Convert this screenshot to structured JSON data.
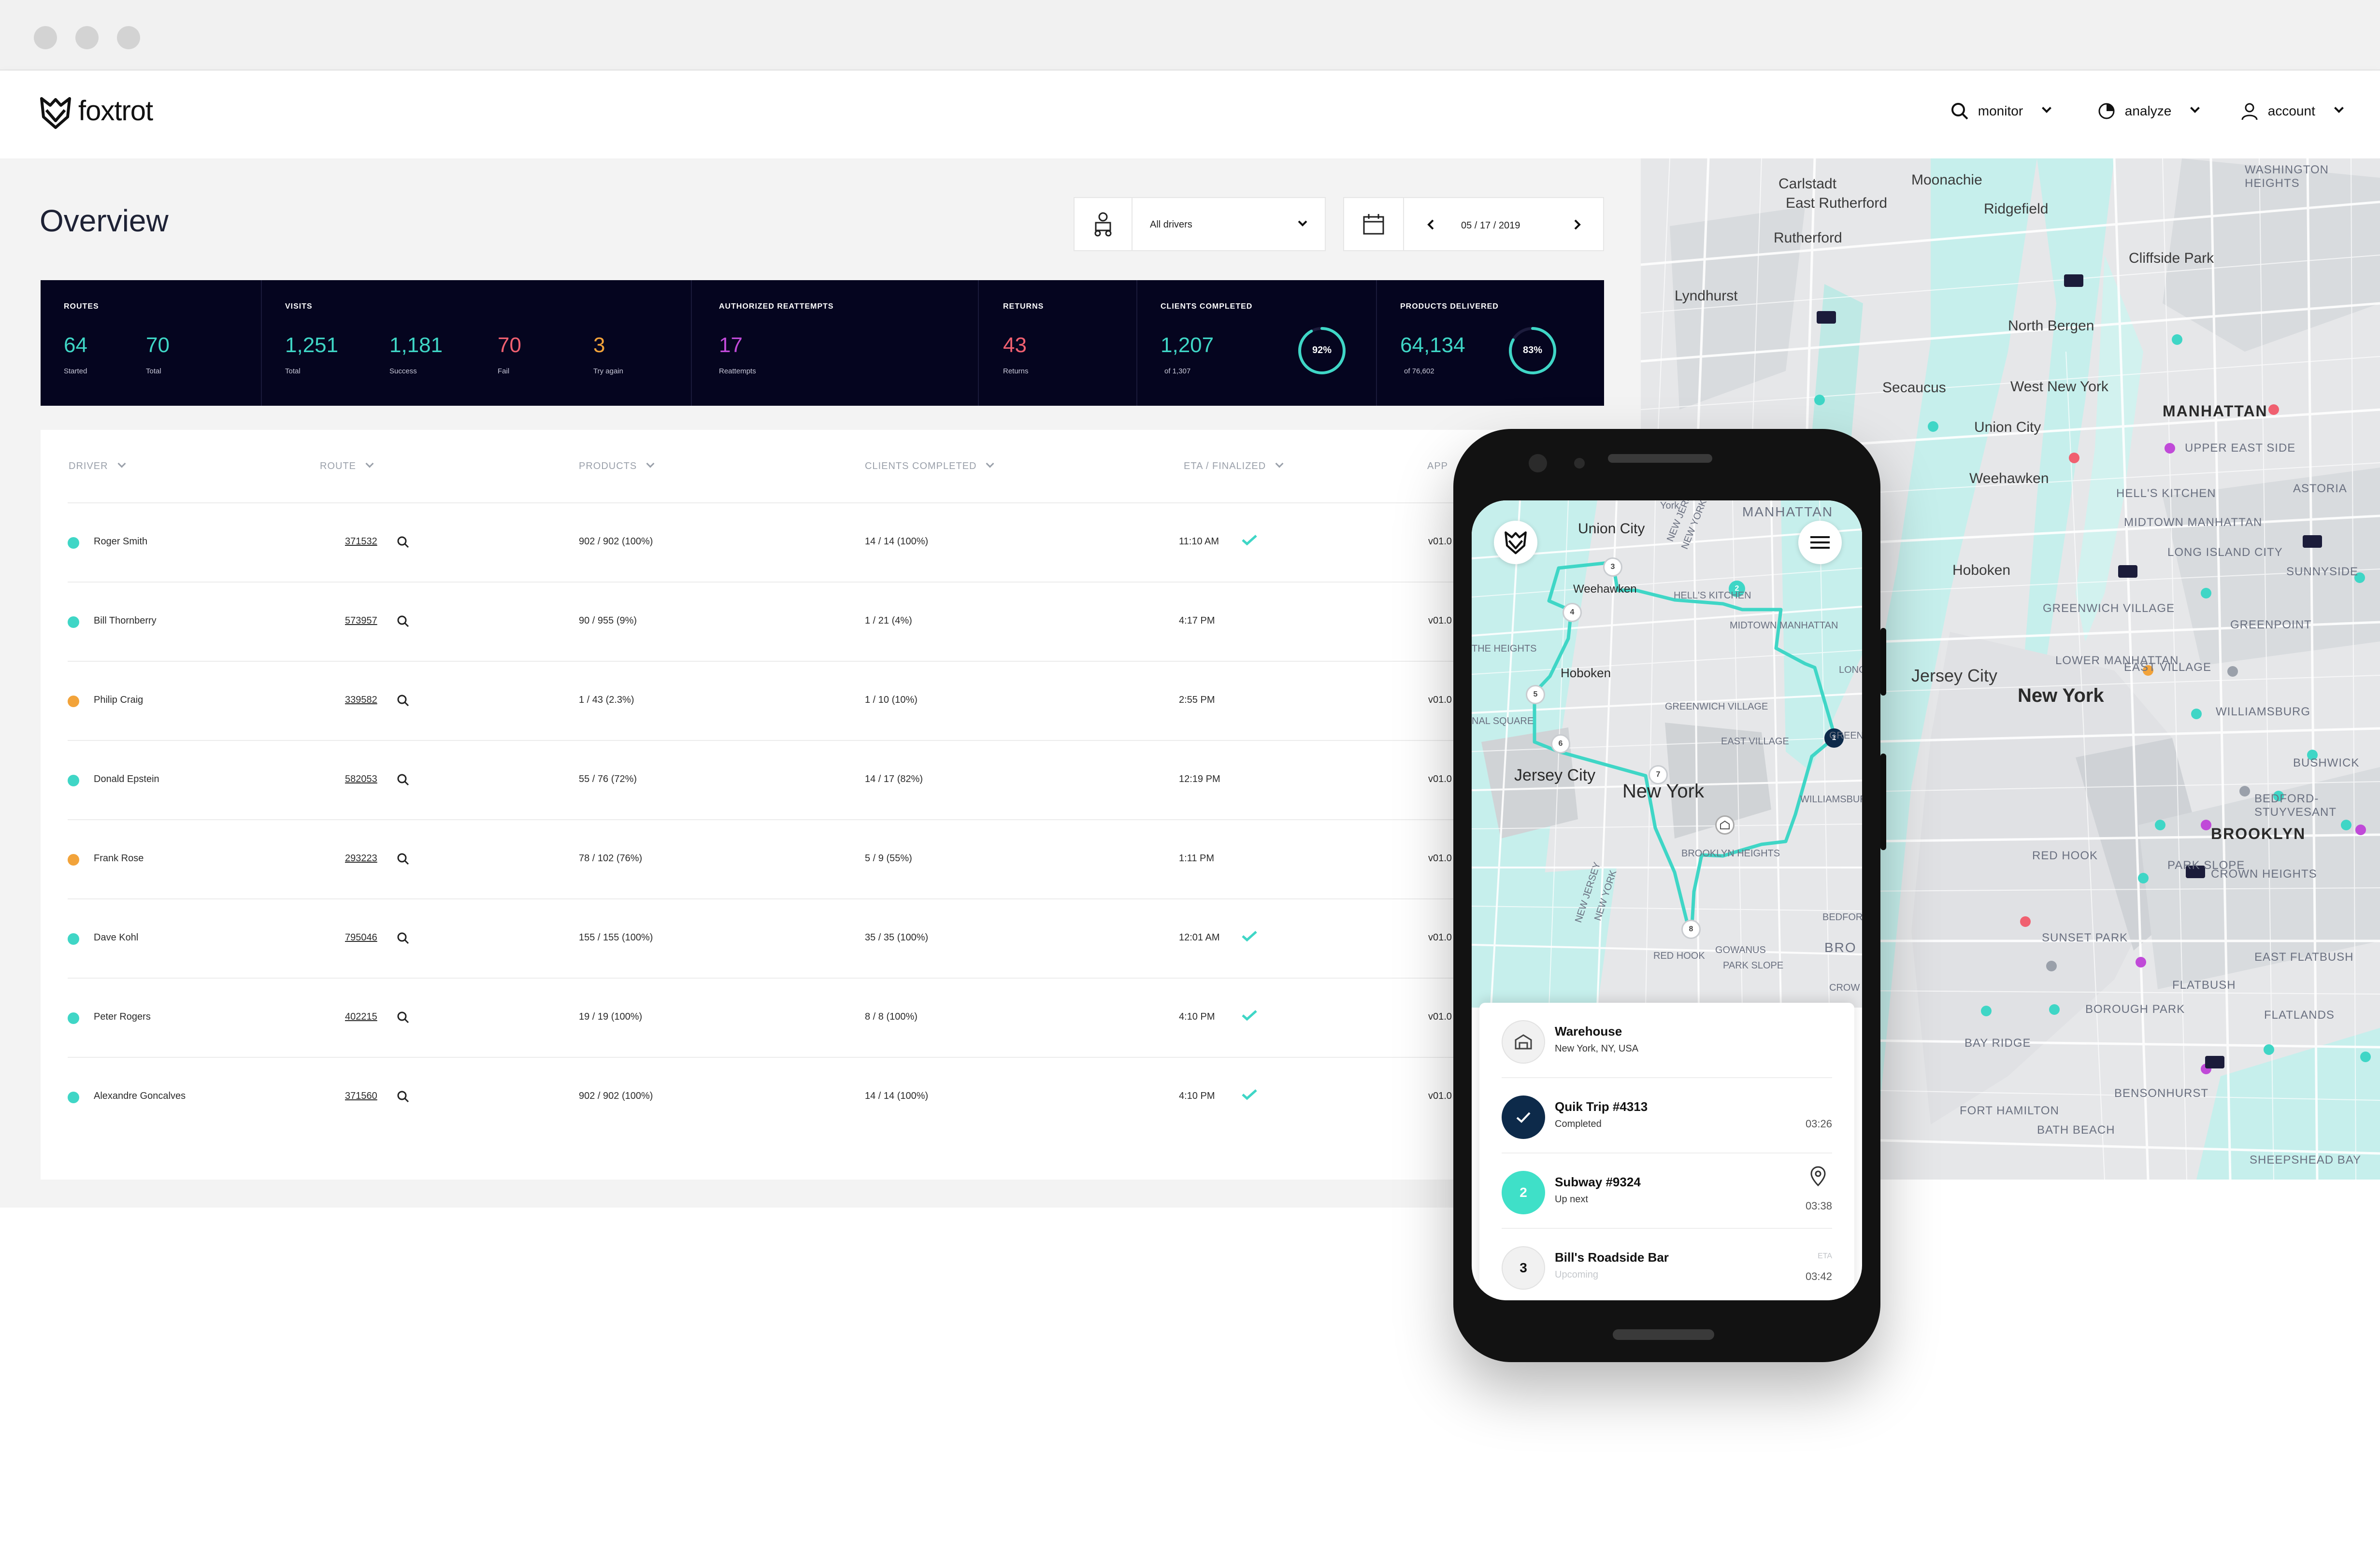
{
  "app": {
    "brand": "foxtrot"
  },
  "nav": {
    "monitor": "monitor",
    "analyze": "analyze",
    "account": "account"
  },
  "overview": {
    "title": "Overview",
    "driver_filter": "All drivers",
    "date": "05 / 17 / 2019"
  },
  "stats": {
    "routes": {
      "label": "ROUTES",
      "started": "64",
      "started_label": "Started",
      "total": "70",
      "total_label": "Total"
    },
    "visits": {
      "label": "VISITS",
      "total": "1,251",
      "total_label": "Total",
      "success": "1,181",
      "success_label": "Success",
      "fail": "70",
      "fail_label": "Fail",
      "try_again": "3",
      "try_again_label": "Try again"
    },
    "reattempts": {
      "label": "AUTHORIZED REATTEMPTS",
      "value": "17",
      "sub": "Reattempts"
    },
    "returns": {
      "label": "RETURNS",
      "value": "43",
      "sub": "Returns"
    },
    "clients": {
      "label": "CLIENTS COMPLETED",
      "value": "1,207",
      "sub": "of 1,307",
      "percent_label": "92%",
      "percent": 0.92
    },
    "products": {
      "label": "PRODUCTS DELIVERED",
      "value": "64,134",
      "sub": "of 76,602",
      "percent_label": "83%",
      "percent": 0.83
    }
  },
  "table": {
    "headers": {
      "driver": "DRIVER",
      "route": "ROUTE",
      "products": "PRODUCTS",
      "clients": "CLIENTS COMPLETED",
      "eta": "ETA / FINALIZED",
      "app": "APP"
    },
    "rows": [
      {
        "driver": "Roger Smith",
        "status": "#3fd6c6",
        "route": "371532",
        "products": "902 / 902 (100%)",
        "clients": "14 / 14 (100%)",
        "eta": "11:10 AM",
        "done": true,
        "app": "v01.0"
      },
      {
        "driver": "Bill Thornberry",
        "status": "#3fd6c6",
        "route": "573957",
        "products": "90 / 955 (9%)",
        "clients": "1 / 21 (4%)",
        "eta": "4:17 PM",
        "done": false,
        "app": "v01.0"
      },
      {
        "driver": "Philip Craig",
        "status": "#f2a33a",
        "route": "339582",
        "products": "1 / 43 (2.3%)",
        "clients": "1 / 10 (10%)",
        "eta": "2:55 PM",
        "done": false,
        "app": "v01.0"
      },
      {
        "driver": "Donald Epstein",
        "status": "#3fd6c6",
        "route": "582053",
        "products": "55 / 76 (72%)",
        "clients": "14 / 17 (82%)",
        "eta": "12:19 PM",
        "done": false,
        "app": "v01.0"
      },
      {
        "driver": "Frank Rose",
        "status": "#f2a33a",
        "route": "293223",
        "products": "78 / 102 (76%)",
        "clients": "5 / 9 (55%)",
        "eta": "1:11 PM",
        "done": false,
        "app": "v01.0"
      },
      {
        "driver": "Dave Kohl",
        "status": "#3fd6c6",
        "route": "795046",
        "products": "155 / 155 (100%)",
        "clients": "35 / 35 (100%)",
        "eta": "12:01 AM",
        "done": true,
        "app": "v01.0"
      },
      {
        "driver": "Peter Rogers",
        "status": "#3fd6c6",
        "route": "402215",
        "products": "19 / 19 (100%)",
        "clients": "8 / 8 (100%)",
        "eta": "4:10 PM",
        "done": true,
        "app": "v01.0"
      },
      {
        "driver": "Alexandre Goncalves",
        "status": "#3fd6c6",
        "route": "371560",
        "products": "902 / 902 (100%)",
        "clients": "14 / 14 (100%)",
        "eta": "4:10 PM",
        "done": true,
        "app": "v01.0"
      }
    ]
  },
  "map": {
    "labels": [
      "Carlstadt",
      "East Rutherford",
      "Rutherford",
      "Moonachie",
      "Ridgefield",
      "Cliffside Park",
      "Lyndhurst",
      "North Bergen",
      "Secaucus",
      "West New York",
      "Union City",
      "Weehawken",
      "Hoboken",
      "Jersey City"
    ],
    "big": [
      "New York",
      "MANHATTAN",
      "BROOKLYN"
    ],
    "small": [
      "WASHINGTON HEIGHTS",
      "ASTORIA",
      "SUNNYSIDE",
      "GREENPOINT",
      "WILLIAMSBURG",
      "BUSHWICK",
      "BEDFORD-STUYVESANT",
      "CROWN HEIGHTS",
      "EAST FLATBUSH",
      "FLATLANDS",
      "BENSONHURST",
      "BATH BEACH",
      "FORT HAMILTON",
      "BAY RIDGE",
      "SUNSET PARK",
      "BOROUGH PARK",
      "PARK SLOPE",
      "FLATBUSH",
      "LONG ISLAND CITY",
      "UPPER EAST SIDE",
      "MIDTOWN MANHATTAN",
      "HELL'S KITCHEN",
      "GREENWICH VILLAGE",
      "LOWER MANHATTAN",
      "EAST VILLAGE",
      "RED HOOK",
      "SHEEPSHEAD BAY"
    ]
  },
  "phone": {
    "map_labels": {
      "union_city": "Union City",
      "weehawken": "Weehawken",
      "hoboken": "Hoboken",
      "jersey_city": "Jersey City",
      "new_york": "New York",
      "manhattan": "MANHATTAN",
      "hells": "HELL'S KITCHEN",
      "midtown": "MIDTOWN MANHATTAN",
      "greenwich": "GREENWICH VILLAGE",
      "east_village": "EAST VILLAGE",
      "brooklyn_heights": "BROOKLYN HEIGHTS",
      "red_hook": "RED HOOK",
      "park_slope": "PARK SLOPE",
      "gowanus": "GOWANUS",
      "williamsburg": "WILLIAMSBURG",
      "the_heights": "THE HEIGHTS",
      "bedford": "BEDFORD",
      "bro": "BRO",
      "york": "York",
      "crow": "CROW",
      "nal_square": "NAL SQUARE",
      "long": "LONG",
      "greenp": "GREENPO",
      "new_jersey_1": "NEW JERSEY",
      "new_york_1": "NEW YORK",
      "new_jersey_2": "NEW JERSEY",
      "new_york_2": "NEW YORK"
    },
    "stops": [
      {
        "title": "Warehouse",
        "sub": "New York, NY, USA",
        "eta": "",
        "badge": ""
      },
      {
        "title": "Quik Trip #4313",
        "sub": "Completed",
        "eta": "03:26",
        "badge": ""
      },
      {
        "title": "Subway #9324",
        "sub": "Up next",
        "eta": "03:38",
        "badge": "2"
      },
      {
        "title": "Bill's Roadside Bar",
        "sub": "Upcoming",
        "eta": "03:42",
        "eta_label": "ETA",
        "badge": "3"
      }
    ],
    "route_markers": [
      "1",
      "3",
      "4",
      "5",
      "6",
      "7",
      "8"
    ]
  }
}
